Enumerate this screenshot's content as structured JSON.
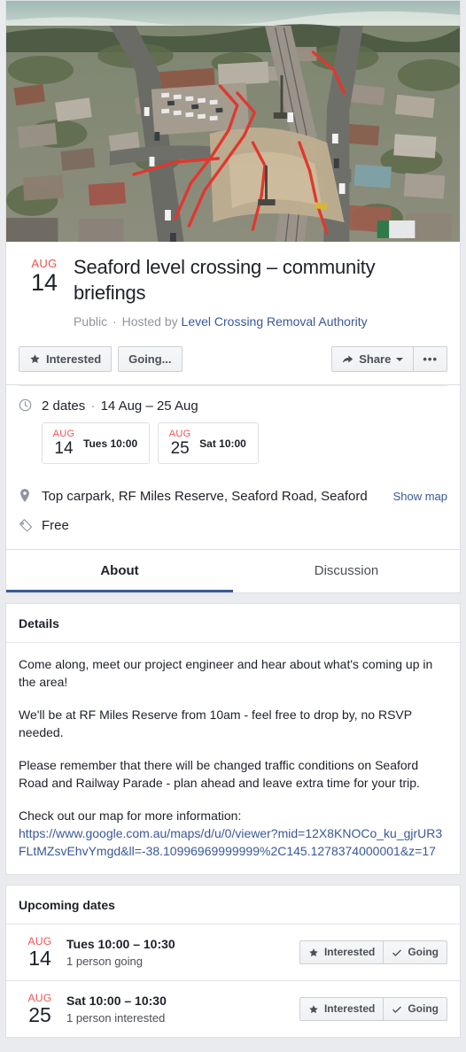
{
  "hero": {
    "alt": "aerial-photo-level-crossing-construction"
  },
  "event": {
    "month": "AUG",
    "day": "14",
    "title": "Seaford level crossing – community briefings",
    "privacy": "Public",
    "hosted_by_label": "Hosted by",
    "host": "Level Crossing Removal Authority",
    "separator": "·"
  },
  "actions": {
    "interested": "Interested",
    "going": "Going...",
    "share": "Share",
    "more": "•••"
  },
  "info": {
    "dates_summary": "2 dates",
    "dates_range": "14 Aug – 25 Aug",
    "separator": "·",
    "location": "Top carpark, RF Miles Reserve, Seaford Road, Seaford",
    "show_map": "Show map",
    "price": "Free",
    "date_pills": [
      {
        "month": "AUG",
        "day": "14",
        "label": "Tues 10:00"
      },
      {
        "month": "AUG",
        "day": "25",
        "label": "Sat 10:00"
      }
    ]
  },
  "tabs": [
    {
      "label": "About",
      "active": true
    },
    {
      "label": "Discussion",
      "active": false
    }
  ],
  "details": {
    "heading": "Details",
    "paragraphs": [
      "Come along, meet our project engineer and hear about what's coming up in the area!",
      "We'll be at RF Miles Reserve from 10am - feel free to drop by, no RSVP needed.",
      "Please remember that there will be changed traffic conditions on Seaford Road and Railway Parade - plan ahead and leave extra time for your trip."
    ],
    "map_intro": "Check out our map for more information:",
    "map_url": "https://www.google.com.au/maps/d/u/0/viewer?mid=12X8KNOCo_ku_gjrUR3FLtMZsvEhvYmgd&ll=-38.10996969999999%2C145.1278374000001&z=17"
  },
  "upcoming": {
    "heading": "Upcoming dates",
    "rows": [
      {
        "month": "AUG",
        "day": "14",
        "when": "Tues 10:00 – 10:30",
        "count": "1 person going",
        "interested": "Interested",
        "going": "Going"
      },
      {
        "month": "AUG",
        "day": "25",
        "when": "Sat 10:00 – 10:30",
        "count": "1 person interested",
        "interested": "Interested",
        "going": "Going"
      }
    ]
  },
  "colors": {
    "accent_red": "#f0534f",
    "link_blue": "#385898",
    "brand_blue": "#3b5998",
    "page_bg": "#e9ebee",
    "border": "#dddfe2"
  }
}
